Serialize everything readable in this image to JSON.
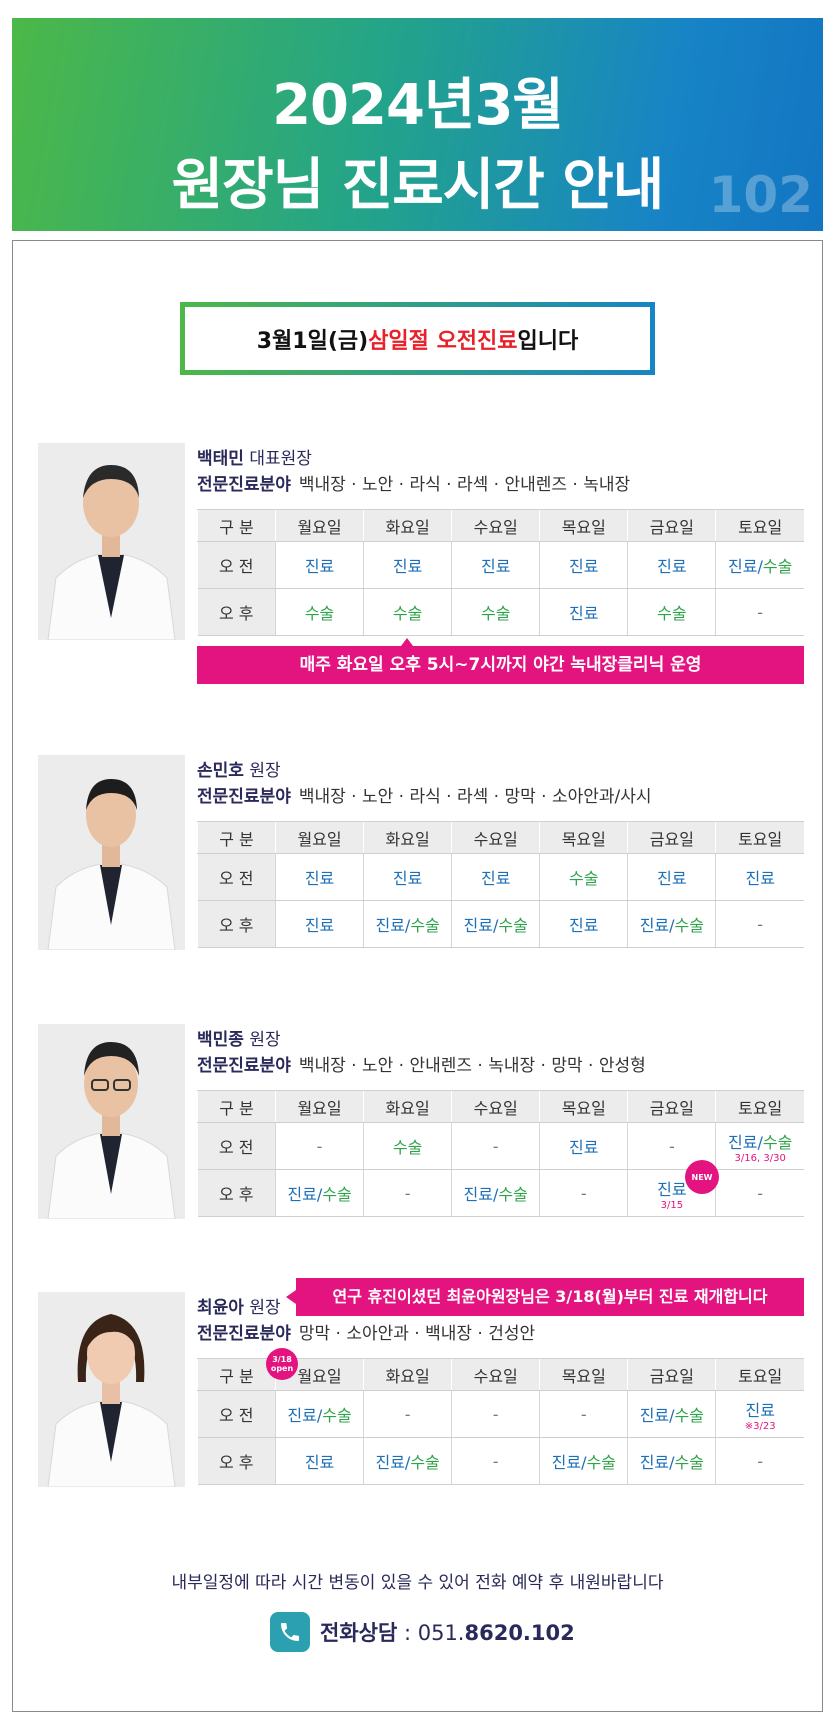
{
  "banner": {
    "line1": "2024년3월",
    "line2": "원장님 진료시간 안내",
    "code": "102"
  },
  "notice": {
    "prefix": "3월1일(금) ",
    "highlight": "삼일절 오전진료",
    "suffix": "입니다"
  },
  "table_headers": [
    "구 분",
    "월요일",
    "화요일",
    "수요일",
    "목요일",
    "금요일",
    "토요일"
  ],
  "row_labels": [
    "오 전",
    "오 후"
  ],
  "spec_label": "전문진료분야",
  "doctors": [
    {
      "name": "백태민",
      "title": " 대표원장",
      "specialty": "백내장 · 노안 · 라식 · 라섹 · 안내렌즈 · 녹내장",
      "am": [
        "진료",
        "진료",
        "진료",
        "진료",
        "진료",
        "진료/수술"
      ],
      "pm": [
        "수술",
        "수술",
        "수술",
        "진료",
        "수술",
        "-"
      ],
      "note": "매주 화요일 오후 5시~7시까지 야간 녹내장클리닉 운영"
    },
    {
      "name": "손민호",
      "title": " 원장",
      "specialty": "백내장 · 노안 · 라식 · 라섹 · 망막 · 소아안과/사시",
      "am": [
        "진료",
        "진료",
        "진료",
        "수술",
        "진료",
        "진료"
      ],
      "pm": [
        "진료",
        "진료/수술",
        "진료/수술",
        "진료",
        "진료/수술",
        "-"
      ]
    },
    {
      "name": "백민종",
      "title": " 원장",
      "specialty": "백내장 · 노안 · 안내렌즈 · 녹내장 · 망막 · 안성형",
      "am": [
        "-",
        "수술",
        "-",
        "진료",
        "-",
        "진료/수술"
      ],
      "am_sat_note": "3/16, 3/30",
      "pm": [
        "진료/수술",
        "-",
        "진료/수술",
        "-",
        "진료",
        "-"
      ],
      "pm_fri_note": "3/15",
      "new_badge": "NEW"
    },
    {
      "name": "최윤아",
      "title": " 원장",
      "specialty": "망막 · 소아안과 · 백내장 · 건성안",
      "am": [
        "진료/수술",
        "-",
        "-",
        "-",
        "진료/수술",
        "진료"
      ],
      "am_sat_note": "※3/23",
      "pm": [
        "진료",
        "진료/수술",
        "-",
        "진료/수술",
        "진료/수술",
        "-"
      ],
      "note": "연구 휴진이셨던 최윤아원장님은 3/18(월)부터 진료 재개합니다",
      "open_badge_line1": "3/18",
      "open_badge_line2": "open"
    }
  ],
  "footer": {
    "message": "내부일정에 따라 시간 변동이 있을 수 있어 전화 예약 후 내원바랍니다",
    "phone_label": "전화상담",
    "phone_sep": " : ",
    "phone_prefix": "051.",
    "phone_number": "8620.102"
  },
  "colors": {
    "blue": "#1d6fb8",
    "green": "#2fa34a",
    "pink": "#e3147f",
    "red": "#e8202a"
  }
}
